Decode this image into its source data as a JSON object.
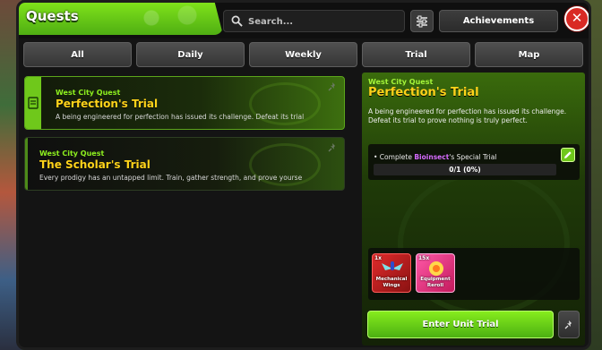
{
  "header": {
    "title": "Quests",
    "search_placeholder": "Search...",
    "achievements_label": "Achievements",
    "close_icon": "close-icon",
    "filter_icon": "sliders-icon"
  },
  "tabs": [
    {
      "label": "All"
    },
    {
      "label": "Daily"
    },
    {
      "label": "Weekly"
    },
    {
      "label": "Trial"
    },
    {
      "label": "Map"
    }
  ],
  "quests": [
    {
      "city": "West City Quest",
      "name": "Perfection's Trial",
      "description": "A being engineered for perfection has issued its challenge. Defeat its trial",
      "selected": true
    },
    {
      "city": "West City Quest",
      "name": "The Scholar's Trial",
      "description": "Every prodigy has an untapped limit. Train, gather strength, and prove yourse",
      "selected": false
    }
  ],
  "detail": {
    "city": "West City Quest",
    "name": "Perfection's Trial",
    "description": "A being engineered for perfection has issued its challenge. Defeat its trial to prove nothing is truly perfect.",
    "objective": {
      "prefix": "• Complete ",
      "highlight": "Bioinsect",
      "suffix": "'s Special Trial",
      "count": "0/1 (0%)",
      "progress": 0
    },
    "rewards": [
      {
        "qty": "1x",
        "name": "Mechanical Wings",
        "icon": "wings-icon"
      },
      {
        "qty": "15x",
        "name": "Equipment Reroll",
        "icon": "reroll-icon"
      }
    ],
    "enter_label": "Enter Unit Trial",
    "pin_icon": "pin-icon"
  },
  "colors": {
    "accent_green": "#6fc81b",
    "quest_title_yellow": "#ffd31a",
    "close_red": "#d92a24",
    "highlight_purple": "#d66bff"
  }
}
